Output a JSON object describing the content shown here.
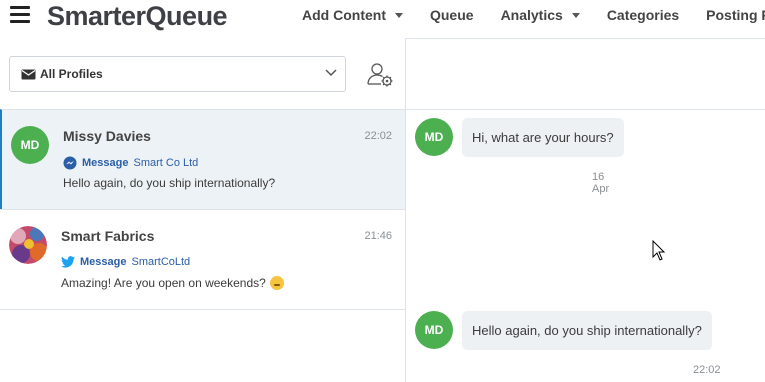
{
  "app": {
    "logo_text": "SmarterQueue"
  },
  "nav": {
    "items": [
      {
        "label": "Add Content",
        "has_dropdown": true
      },
      {
        "label": "Queue",
        "has_dropdown": false
      },
      {
        "label": "Analytics",
        "has_dropdown": true
      },
      {
        "label": "Categories",
        "has_dropdown": false
      },
      {
        "label": "Posting Plan",
        "has_dropdown": false
      }
    ]
  },
  "inbox": {
    "profile_filter": {
      "selected": "All Profiles"
    },
    "conversations": [
      {
        "initials": "MD",
        "name": "Missy Davies",
        "time": "22:02",
        "network": "facebook-messenger",
        "kind": "Message",
        "account": "Smart Co Ltd",
        "preview": "Hello again, do you ship internationally?",
        "active": true
      },
      {
        "initials": "",
        "name": "Smart Fabrics",
        "time": "21:46",
        "network": "twitter",
        "kind": "Message",
        "account": "SmartCoLtd",
        "preview": "Amazing! Are you open on weekends?",
        "active": false
      }
    ]
  },
  "thread": {
    "messages": [
      {
        "initials": "MD",
        "text": "Hi, what are your hours?",
        "stamp": "16 Apr"
      },
      {
        "initials": "MD",
        "text": "Hello again, do you ship internationally?",
        "stamp": "22:02"
      }
    ]
  },
  "colors": {
    "avatar_green": "#4caf50",
    "link_blue": "#2a5ea8",
    "active_row": "#edf2f6",
    "bubble": "#eef1f4",
    "twitter_blue": "#1da1f2"
  }
}
